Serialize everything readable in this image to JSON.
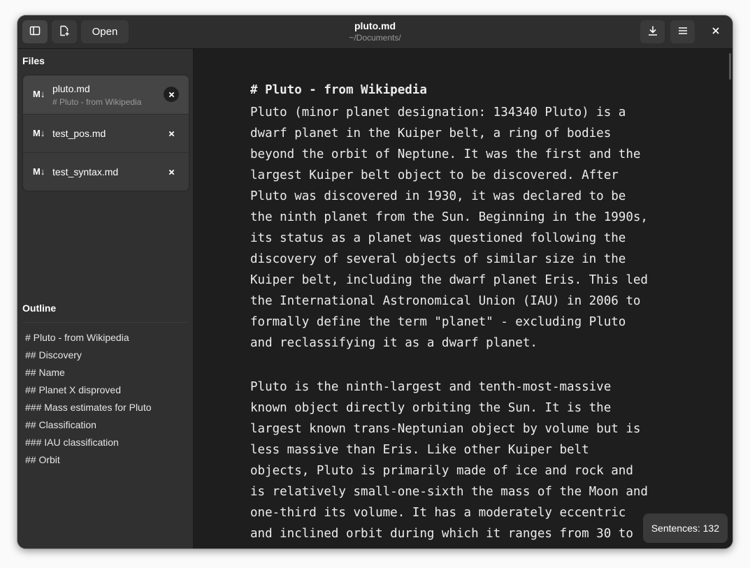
{
  "window": {
    "title": "pluto.md",
    "subtitle": "~/Documents/"
  },
  "header": {
    "sidebar_toggle_icon": "sidebar-toggle-icon",
    "new_file_icon": "new-document-icon",
    "open_label": "Open",
    "save_icon": "download-icon",
    "menu_icon": "hamburger-menu-icon",
    "close_icon": "close-icon"
  },
  "sidebar": {
    "files_title": "Files",
    "files": [
      {
        "icon": "M↓",
        "name": "pluto.md",
        "subtitle": "# Pluto - from Wikipedia",
        "active": true
      },
      {
        "icon": "M↓",
        "name": "test_pos.md",
        "subtitle": "",
        "active": false
      },
      {
        "icon": "M↓",
        "name": "test_syntax.md",
        "subtitle": "",
        "active": false
      }
    ],
    "outline_title": "Outline",
    "outline": [
      "# Pluto - from Wikipedia",
      "## Discovery",
      "## Name",
      "## Planet X disproved",
      "### Mass estimates for Pluto",
      "## Classification",
      "### IAU classification",
      "## Orbit"
    ]
  },
  "editor": {
    "heading": "# Pluto - from Wikipedia",
    "paragraphs": [
      [
        "Pluto (minor planet designation: 134340 Pluto) is a",
        "dwarf planet in the Kuiper belt, a ring of bodies",
        "beyond the orbit of Neptune. It was the first and the",
        "largest Kuiper belt object to be discovered. After",
        "Pluto was discovered in 1930, it was declared to be",
        "the ninth planet from the Sun. Beginning in the 1990s,",
        "its status as a planet was questioned following the",
        "discovery of several objects of similar size in the",
        "Kuiper belt, including the dwarf planet Eris. This led",
        "the International Astronomical Union (IAU) in 2006 to",
        "formally define the term \"planet\" - excluding Pluto",
        "and reclassifying it as a dwarf planet."
      ],
      [
        "Pluto is the ninth-largest and tenth-most-massive",
        "known object directly orbiting the Sun. It is the",
        "largest known trans-Neptunian object by volume but is",
        "less massive than Eris. Like other Kuiper belt",
        "objects, Pluto is primarily made of ice and rock and",
        "is relatively small-one-sixth the mass of the Moon and",
        "one-third its volume. It has a moderately eccentric",
        "and inclined orbit during which it ranges from 30 to"
      ]
    ]
  },
  "status": {
    "sentences": "Sentences: 132"
  }
}
